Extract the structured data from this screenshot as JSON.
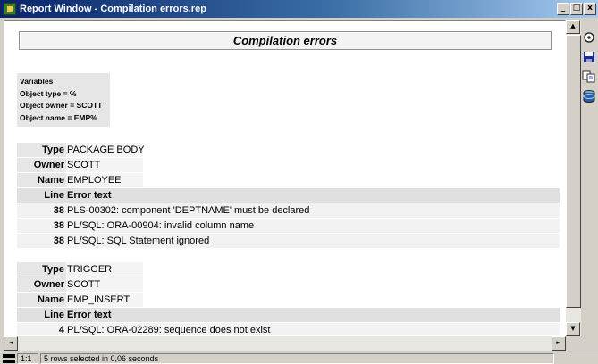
{
  "window": {
    "title": "Report Window - Compilation errors.rep",
    "minimize": "_",
    "restore": "□",
    "close": "x"
  },
  "report": {
    "heading": "Compilation errors",
    "variables": {
      "title": "Variables",
      "lines": [
        "Object type = %",
        "Object owner = SCOTT",
        "Object name = EMP%"
      ]
    },
    "labels": {
      "type": "Type",
      "owner": "Owner",
      "name": "Name",
      "line": "Line",
      "error_text": "Error text"
    },
    "groups": [
      {
        "type": "PACKAGE BODY",
        "owner": "SCOTT",
        "name": "EMPLOYEE",
        "errors": [
          {
            "line": "38",
            "text": "PLS-00302: component 'DEPTNAME' must be declared"
          },
          {
            "line": "38",
            "text": "PL/SQL: ORA-00904: invalid column name"
          },
          {
            "line": "38",
            "text": "PL/SQL: SQL Statement ignored"
          }
        ]
      },
      {
        "type": "TRIGGER",
        "owner": "SCOTT",
        "name": "EMP_INSERT",
        "errors": [
          {
            "line": "4",
            "text": "PL/SQL: ORA-02289: sequence does not exist"
          }
        ]
      }
    ]
  },
  "scroll": {
    "up": "▲",
    "down": "▼",
    "left": "◄",
    "right": "►"
  },
  "toolbar": {
    "icons": [
      "print-icon",
      "save-icon",
      "copy-icon",
      "database-icon"
    ]
  },
  "status": {
    "zoom": "1:1",
    "message": "5 rows selected in 0,06 seconds"
  }
}
